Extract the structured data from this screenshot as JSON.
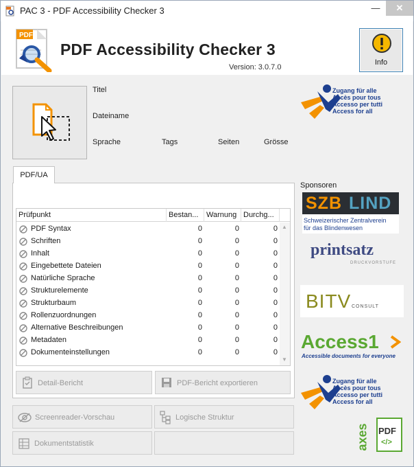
{
  "window": {
    "title": "PAC 3 - PDF Accessibility Checker 3",
    "min_glyph": "—",
    "close_glyph": "✕"
  },
  "header": {
    "app_name": "PDF Accessibility Checker 3",
    "version": "Version: 3.0.7.0",
    "info_label": "Info"
  },
  "document": {
    "title_label": "Titel",
    "filename_label": "Dateiname",
    "language_label": "Sprache",
    "tags_label": "Tags",
    "pages_label": "Seiten",
    "size_label": "Grösse"
  },
  "tabs": [
    {
      "label": "PDF/UA"
    }
  ],
  "grid": {
    "columns": [
      "Prüfpunkt",
      "Bestan...",
      "Warnung",
      "Durchg..."
    ],
    "rows": [
      {
        "name": "PDF Syntax",
        "passed": "0",
        "warning": "0",
        "failed": "0"
      },
      {
        "name": "Schriften",
        "passed": "0",
        "warning": "0",
        "failed": "0"
      },
      {
        "name": "Inhalt",
        "passed": "0",
        "warning": "0",
        "failed": "0"
      },
      {
        "name": "Eingebettete Dateien",
        "passed": "0",
        "warning": "0",
        "failed": "0"
      },
      {
        "name": "Natürliche Sprache",
        "passed": "0",
        "warning": "0",
        "failed": "0"
      },
      {
        "name": "Strukturelemente",
        "passed": "0",
        "warning": "0",
        "failed": "0"
      },
      {
        "name": "Strukturbaum",
        "passed": "0",
        "warning": "0",
        "failed": "0"
      },
      {
        "name": "Rollenzuordnungen",
        "passed": "0",
        "warning": "0",
        "failed": "0"
      },
      {
        "name": "Alternative Beschreibungen",
        "passed": "0",
        "warning": "0",
        "failed": "0"
      },
      {
        "name": "Metadaten",
        "passed": "0",
        "warning": "0",
        "failed": "0"
      },
      {
        "name": "Dokumenteinstellungen",
        "passed": "0",
        "warning": "0",
        "failed": "0"
      }
    ]
  },
  "buttons": {
    "detail_report": "Detail-Bericht",
    "export_pdf_report": "PDF-Bericht exportieren",
    "screenreader_preview": "Screenreader-Vorschau",
    "logical_structure": "Logische Struktur",
    "document_statistics": "Dokumentstatistik"
  },
  "sponsors": {
    "heading": "Sponsoren",
    "access_for_all_lines": [
      "Zugang für alle",
      "Accès pour tous",
      "Accesso per tutti",
      "Access for all"
    ],
    "szblind_main": "SZB",
    "szblind_accent": "LIND",
    "szblind_sub": [
      "Schweizerischer Zentralverein",
      "für das Blindenwesen"
    ],
    "printsatz_main": "printsatz",
    "printsatz_sub": "DRUCKVORSTUFE",
    "bitv_main": "BITV",
    "bitv_sub": "CONSULT",
    "access1_main": "Access1",
    "access1_sub": "Accessible documents for everyone",
    "axes_main": "axes",
    "axes_pdf": "PDF",
    "axes_tag": "</>"
  },
  "colors": {
    "accent_orange": "#f39200",
    "accent_blue": "#1d3f8f",
    "szb_teal": "#54a2c1",
    "access1_green": "#5aa832"
  }
}
